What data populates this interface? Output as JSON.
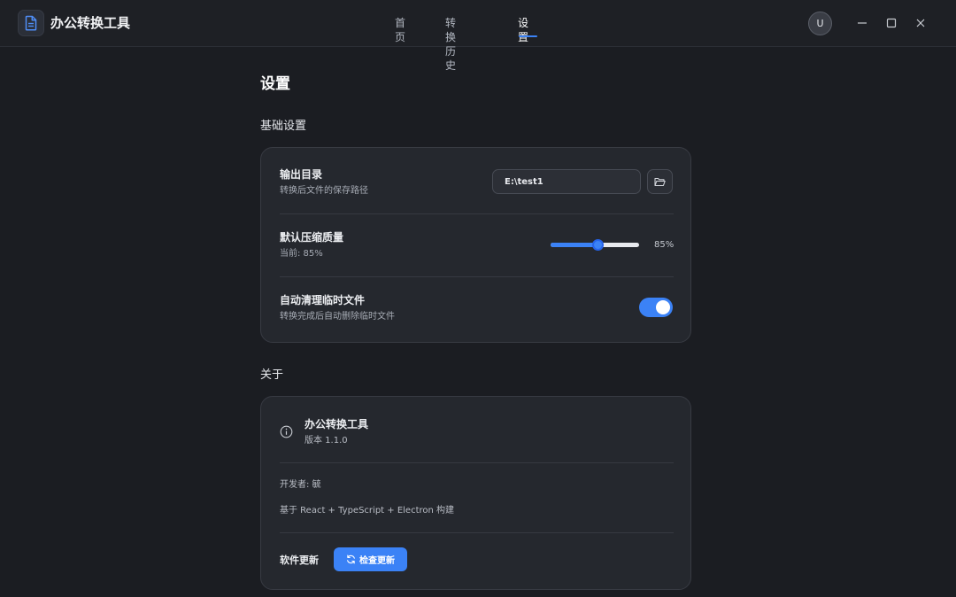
{
  "app": {
    "title": "办公转换工具",
    "icon": "document-icon",
    "accent": "#3b82f6"
  },
  "nav": {
    "items": [
      "首页",
      "转换历史",
      "设置"
    ],
    "active": "设置"
  },
  "user": {
    "avatar_letter": "U"
  },
  "window_controls": {
    "icons": [
      "minimize-icon",
      "maximize-icon",
      "close-icon"
    ]
  },
  "page": {
    "title": "设置"
  },
  "basic": {
    "section_title": "基础设置",
    "output_dir": {
      "title": "输出目录",
      "subtitle": "转换后文件的保存路径",
      "value": "E:\\test1",
      "button_icon": "folder-open-icon"
    },
    "quality": {
      "title": "默认压缩质量",
      "subtitle": "当前: 85%",
      "value_label": "85%",
      "value": 85,
      "max": 100
    },
    "auto_clean": {
      "title": "自动清理临时文件",
      "subtitle": "转换完成后自动删除临时文件",
      "enabled": true
    }
  },
  "about": {
    "section_title": "关于",
    "app_name": "办公转换工具",
    "version": "版本 1.1.0",
    "developer": "开发者: 毓",
    "built_with": "基于 React + TypeScript + Electron 构建",
    "update_label": "软件更新",
    "update_button": "检查更新",
    "update_icon": "refresh-icon"
  }
}
